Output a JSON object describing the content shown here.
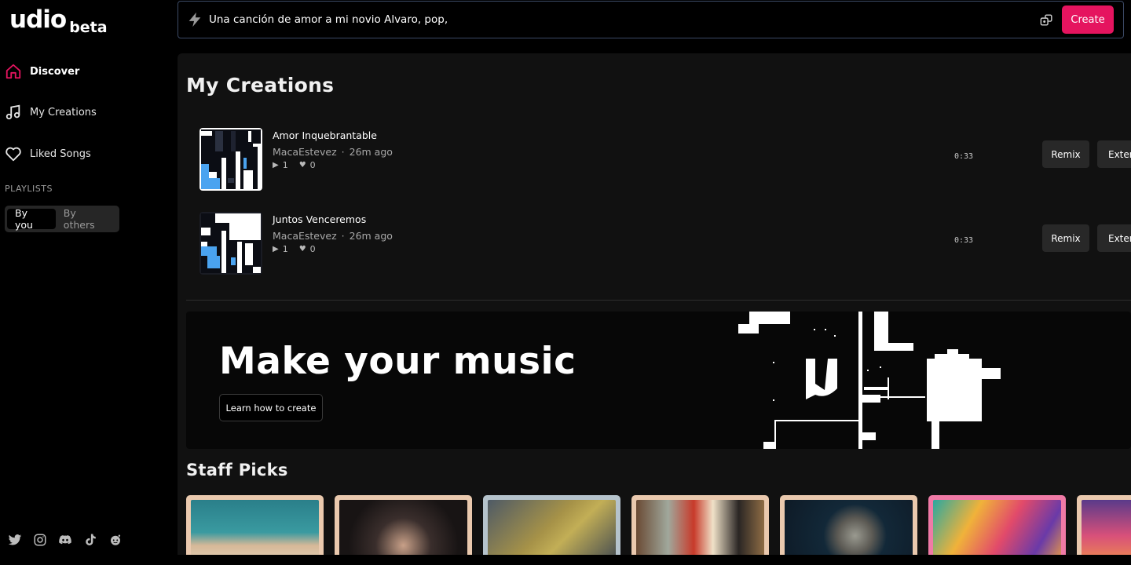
{
  "brand": {
    "wordmark": "udio",
    "badge": "beta"
  },
  "nav": [
    {
      "id": "discover",
      "label": "Discover",
      "icon": "home-icon",
      "active": true
    },
    {
      "id": "my-creations",
      "label": "My Creations",
      "icon": "music-note-icon",
      "active": false
    },
    {
      "id": "liked-songs",
      "label": "Liked Songs",
      "icon": "heart-icon",
      "active": false
    }
  ],
  "playlists": {
    "heading": "PLAYLISTS",
    "tabs": [
      {
        "label": "By you",
        "selected": true
      },
      {
        "label": "By others",
        "selected": false
      }
    ]
  },
  "socials": [
    "twitter-icon",
    "instagram-icon",
    "discord-icon",
    "tiktok-icon",
    "reddit-icon"
  ],
  "prompt": {
    "value": "Una canción de amor a mi novio Alvaro, pop,",
    "create_label": "Create"
  },
  "my_creations": {
    "title": "My Creations",
    "tracks": [
      {
        "title": "Amor Inquebrantable",
        "artist": "MacaEstevez",
        "ago": "26m ago",
        "plays": "1",
        "likes": "0",
        "duration": "0:33",
        "remix_label": "Remix",
        "extend_label": "Exten"
      },
      {
        "title": "Juntos Venceremos",
        "artist": "MacaEstevez",
        "ago": "26m ago",
        "plays": "1",
        "likes": "0",
        "duration": "0:33",
        "remix_label": "Remix",
        "extend_label": "Exten"
      }
    ]
  },
  "banner": {
    "title": "Make your music",
    "cta_label": "Learn how to create"
  },
  "staff_picks": {
    "title": "Staff Picks"
  },
  "colors": {
    "accent": "#e5145f",
    "surface": "#111111",
    "button": "#282828"
  }
}
